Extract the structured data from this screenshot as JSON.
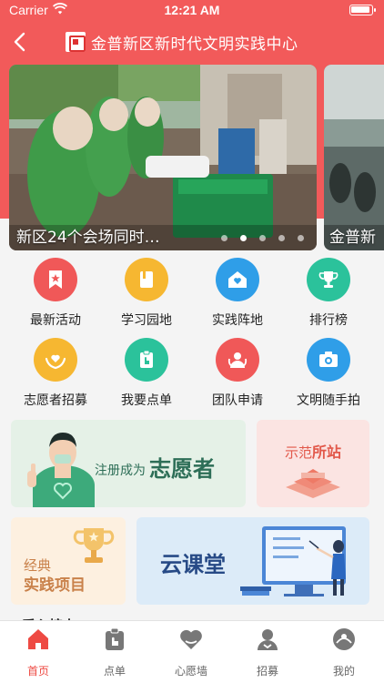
{
  "status": {
    "carrier": "Carrier",
    "time": "12:21 AM"
  },
  "nav": {
    "title": "金普新区新时代文明实践中心"
  },
  "banner": {
    "caption": "新区24个会场同时…",
    "peek_caption": "金普新",
    "dots_count": 5,
    "active_dot": 1
  },
  "grid": [
    {
      "label": "最新活动",
      "icon": "bookmark-star-icon",
      "color": "#f05858"
    },
    {
      "label": "学习园地",
      "icon": "book-icon",
      "color": "#f6b731"
    },
    {
      "label": "实践阵地",
      "icon": "house-heart-icon",
      "color": "#2f9ee8"
    },
    {
      "label": "排行榜",
      "icon": "trophy-icon",
      "color": "#2bc29b"
    },
    {
      "label": "志愿者招募",
      "icon": "hands-heart-icon",
      "color": "#f6b731"
    },
    {
      "label": "我要点单",
      "icon": "clipboard-hand-icon",
      "color": "#2bc29b"
    },
    {
      "label": "团队申请",
      "icon": "team-icon",
      "color": "#f05858"
    },
    {
      "label": "文明随手拍",
      "icon": "camera-icon",
      "color": "#2f9ee8"
    }
  ],
  "cards": {
    "volunteer": {
      "prefix": "注册成为",
      "highlight": "志愿者"
    },
    "demo": {
      "prefix": "示范",
      "highlight": "所站"
    },
    "project": {
      "line1": "经典",
      "line2": "实践项目"
    },
    "cloud": {
      "title": "云课堂"
    }
  },
  "section_peek": "爱心榜上",
  "tabs": [
    {
      "label": "首页",
      "icon": "home-icon",
      "active": true
    },
    {
      "label": "点单",
      "icon": "order-icon",
      "active": false
    },
    {
      "label": "心愿墙",
      "icon": "heart-icon",
      "active": false
    },
    {
      "label": "招募",
      "icon": "recruit-icon",
      "active": false
    },
    {
      "label": "我的",
      "icon": "profile-icon",
      "active": false
    }
  ],
  "colors": {
    "brand_red": "#f25a5a",
    "tab_active": "#ee4a43"
  }
}
